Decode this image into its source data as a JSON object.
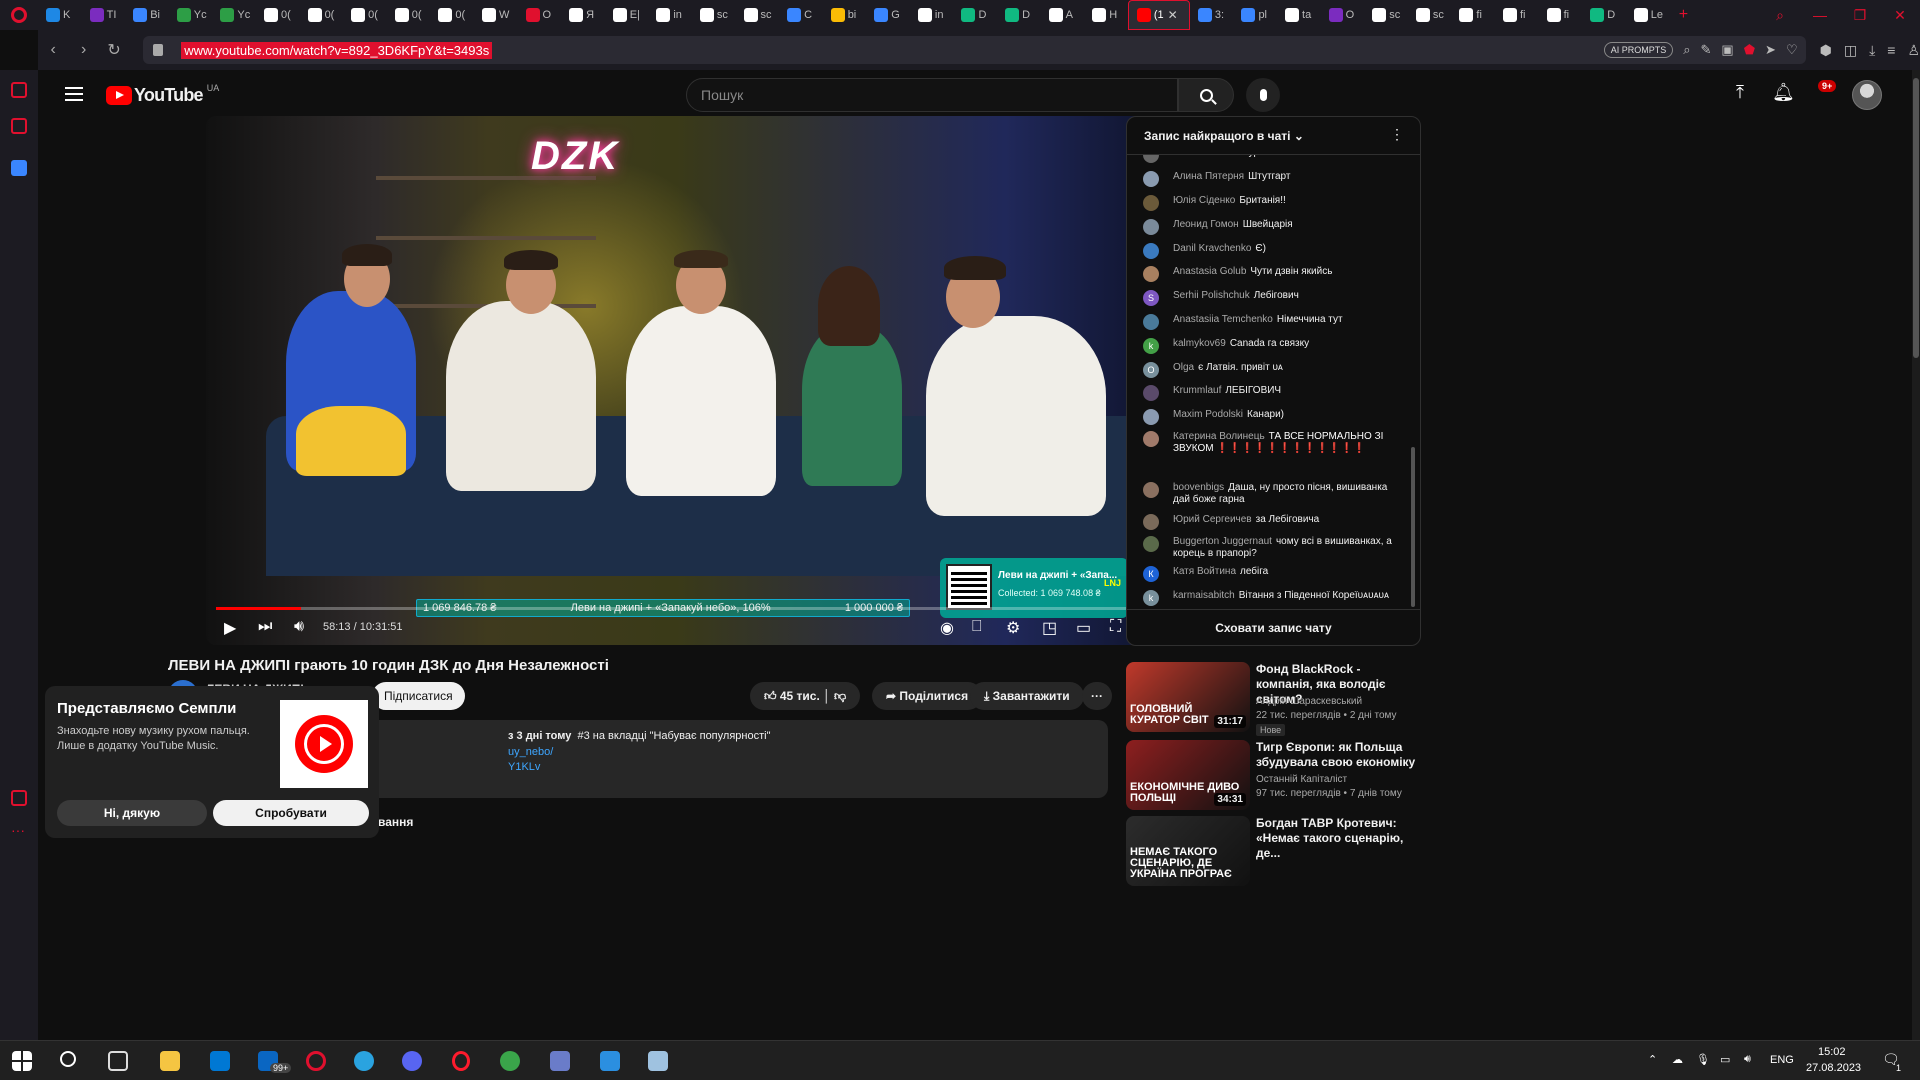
{
  "browser": {
    "tabs": [
      {
        "label": "K",
        "color": "#1e88e5"
      },
      {
        "label": "TI",
        "color": "#7b2cbf"
      },
      {
        "label": "Bi",
        "color": "#3a86ff"
      },
      {
        "label": "Yc",
        "color": "#2d9e46"
      },
      {
        "label": "Yc",
        "color": "#2d9e46"
      },
      {
        "label": "0(",
        "color": "#ffffff"
      },
      {
        "label": "0(",
        "color": "#ffffff"
      },
      {
        "label": "0(",
        "color": "#ffffff"
      },
      {
        "label": "0(",
        "color": "#ffffff"
      },
      {
        "label": "0(",
        "color": "#ffffff"
      },
      {
        "label": "W",
        "color": "#ffffff"
      },
      {
        "label": "O",
        "color": "#e0102e"
      },
      {
        "label": "Я",
        "color": "#ffffff"
      },
      {
        "label": "E|",
        "color": "#ffffff"
      },
      {
        "label": "in",
        "color": "#ffffff"
      },
      {
        "label": "sc",
        "color": "#ffffff"
      },
      {
        "label": "sc",
        "color": "#ffffff"
      },
      {
        "label": "C",
        "color": "#3a86ff"
      },
      {
        "label": "bi",
        "color": "#fbbc05"
      },
      {
        "label": "G",
        "color": "#3a86ff"
      },
      {
        "label": "in",
        "color": "#ffffff"
      },
      {
        "label": "D",
        "color": "#10b981"
      },
      {
        "label": "D",
        "color": "#10b981"
      },
      {
        "label": "A",
        "color": "#ffffff"
      },
      {
        "label": "H",
        "color": "#ffffff"
      }
    ],
    "active_tab": {
      "label": "(1",
      "close": "✕"
    },
    "tabs_after": [
      {
        "label": "3:",
        "color": "#3a86ff"
      },
      {
        "label": "pl",
        "color": "#3a86ff"
      },
      {
        "label": "ta",
        "color": "#ffffff"
      },
      {
        "label": "O",
        "color": "#7b2cbf"
      },
      {
        "label": "sc",
        "color": "#ffffff"
      },
      {
        "label": "sc",
        "color": "#ffffff"
      },
      {
        "label": "fi",
        "color": "#ffffff"
      },
      {
        "label": "fi",
        "color": "#ffffff"
      },
      {
        "label": "fi",
        "color": "#ffffff"
      },
      {
        "label": "D",
        "color": "#10b981"
      },
      {
        "label": "Le",
        "color": "#ffffff"
      }
    ],
    "new_tab": "+",
    "url": "www.youtube.com/watch?v=892_3D6KFpY&t=3493s",
    "ai_prompts": "AI PROMPTS",
    "accent": "#e0102e"
  },
  "youtube": {
    "region": "UA",
    "logo_text": "YouTube",
    "search_placeholder": "Пошук",
    "notifications_badge": "9+",
    "player": {
      "overlay_logo": "DZK",
      "time_display": "58:13 / 10:31:51",
      "progress_fraction": 0.092,
      "donation": {
        "raised": "1 069 846.78 ₴",
        "title": "Леви на джипі + «Запакуй небо», 106%",
        "goal": "1 000 000 ₴",
        "box_title": "Леви на джипі + «Запа...",
        "box_collected": "Collected: 1 069 748.08 ₴",
        "box_tag": "LNJ"
      }
    },
    "video": {
      "title": "ЛЕВИ НА ДЖИПІ грають 10 годин ДЗК до Дня Незалежності",
      "channel": "ЛЕВИ НА ДЖИПІ",
      "subscribe": "Підписатися",
      "likes": "45 тис.",
      "share": "Поділитися",
      "download": "Завантажити",
      "desc_meta": "з 3 дні тому",
      "desc_trend": "#3 на вкладці \"Набуває популярності\"",
      "desc_link1": "uy_nebo/",
      "desc_link2": "Y1KLv",
      "comments_partial": "вання"
    },
    "popup": {
      "title": "Представляємо Семпли",
      "text": "Знаходьте нову музику рухом пальця. Лише в додатку YouTube Music.",
      "decline": "Ні, дякую",
      "accept": "Спробувати"
    },
    "chat": {
      "title": "Запис найкращого в чаті",
      "hide": "Сховати запис чату",
      "messages": [
        {
          "author": "TATIKRATI",
          "text": "Гамбург",
          "initial": "",
          "color": "#666"
        },
        {
          "author": "Алина Пятерня",
          "text": "Штутгарт",
          "initial": "",
          "color": "#8a9bb0"
        },
        {
          "author": "Юлія Сіденко",
          "text": "Британія!!",
          "initial": "",
          "color": "#6b5a3a"
        },
        {
          "author": "Леонид Гомон",
          "text": "Швейцарія",
          "initial": "",
          "color": "#7a8a9a"
        },
        {
          "author": "Danil Kravchenko",
          "text": "Є)",
          "initial": "",
          "color": "#3a7abf"
        },
        {
          "author": "Anastasia Golub",
          "text": "Чути дзвін якийсь",
          "initial": "",
          "color": "#a88060"
        },
        {
          "author": "Serhii Polishchuk",
          "text": "Лебігович",
          "initial": "S",
          "color": "#7e57c2"
        },
        {
          "author": "Anastasiia Temchenko",
          "text": "Німеччина тут",
          "initial": "",
          "color": "#4a7a9a"
        },
        {
          "author": "kalmykov69",
          "text": "Canada га связку",
          "initial": "k",
          "color": "#43a047"
        },
        {
          "author": "Olga",
          "text": "є Латвія. привіт ᴜᴀ",
          "initial": "O",
          "color": "#78909c"
        },
        {
          "author": "Krummlauf",
          "text": "ЛЕБІГОВИЧ",
          "initial": "",
          "color": "#5a4a6a"
        },
        {
          "author": "Maxim Podolski",
          "text": "Канари)",
          "initial": "",
          "color": "#8a9ab0"
        },
        {
          "author": "Катерина Волинець",
          "text": "ТА ВСЕ НОРМАЛЬНО ЗІ ЗВУКОМ ❗❗❗❗❗❗❗❗❗❗❗❗",
          "initial": "",
          "color": "#a07a6a"
        },
        {
          "author": "boovenbigs",
          "text": "Даша, ну просто пісня, вишиванка дай боже гарна",
          "initial": "",
          "color": "#8a7060"
        },
        {
          "author": "Юрий Сергеичев",
          "text": "за Лебіговича",
          "initial": "",
          "color": "#7a6a5a"
        },
        {
          "author": "Buggerton Juggernaut",
          "text": "чому всі в вишиванках, а корець в прапорі?",
          "initial": "",
          "color": "#5a6a4a"
        },
        {
          "author": "Катя Войтина",
          "text": "лебіга",
          "initial": "К",
          "color": "#1e63d6"
        },
        {
          "author": "karmaisabitch",
          "text": "Вітання з Південної Кореїᴜᴀᴜᴀᴜᴀ",
          "initial": "k",
          "color": "#78909c"
        }
      ]
    },
    "related": [
      {
        "title": "Фонд BlackRock - компанія, яка володіє світом?",
        "channel": "Андрій Шараскевський",
        "meta": "22 тис. переглядів • 2 дні тому",
        "badge": "Нове",
        "duration": "31:17",
        "thumb_text": "ГОЛОВНИЙ КУРАТОР СВІТ",
        "thumb_color": "#c0392b"
      },
      {
        "title": "Тигр Європи: як Польща збудувала свою економіку",
        "channel": "Останній Капіталіст",
        "meta": "97 тис. переглядів • 7 днів тому",
        "badge": "",
        "duration": "34:31",
        "thumb_text": "ЕКОНОМІЧНЕ ДИВО ПОЛЬЩІ",
        "thumb_color": "#8e1f1f"
      },
      {
        "title": "Богдан ТАВР Кротевич: «Немає такого сценарію, де...",
        "channel": "",
        "meta": "",
        "badge": "",
        "duration": "",
        "thumb_text": "НЕМАЄ ТАКОГО СЦЕНАРІЮ, ДЕ УКРАЇНА ПРОГРАЄ",
        "thumb_color": "#2c2c2c"
      }
    ]
  },
  "taskbar": {
    "language": "ENG",
    "time": "15:02",
    "date": "27.08.2023",
    "mail_badge": "99+",
    "notification_count": "1"
  }
}
